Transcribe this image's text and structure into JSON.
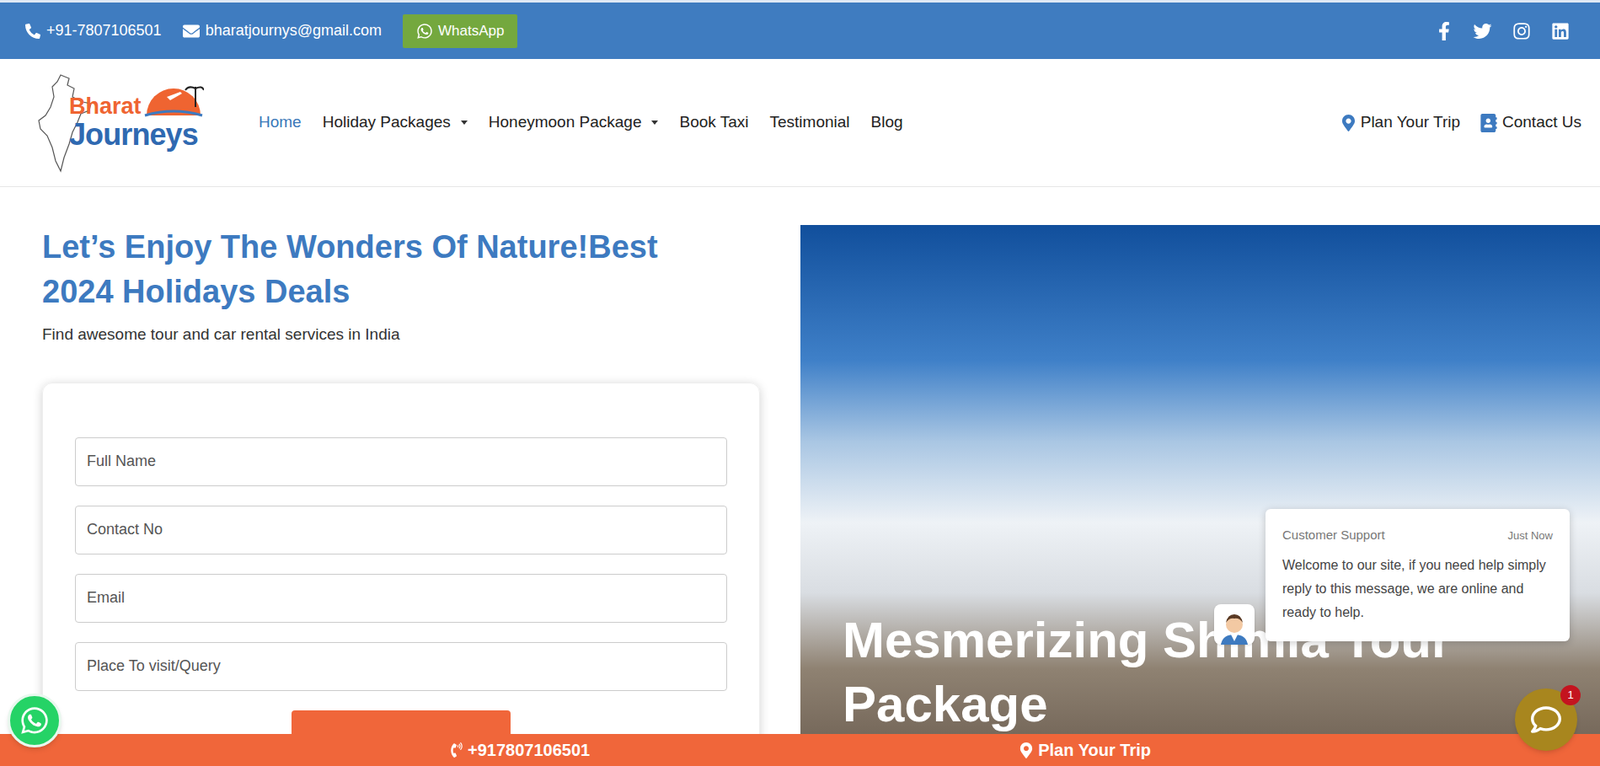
{
  "top_bar": {
    "phone": "+91-7807106501",
    "email": "bharatjournys@gmail.com",
    "whatsapp": "WhatsApp"
  },
  "logo": {
    "line1": "Bharat",
    "line2": "Journeys"
  },
  "nav": {
    "items": [
      {
        "label": "Home",
        "selected": true,
        "dropdown": false
      },
      {
        "label": "Holiday Packages",
        "selected": false,
        "dropdown": true
      },
      {
        "label": "Honeymoon Package",
        "selected": false,
        "dropdown": true
      },
      {
        "label": "Book Taxi",
        "selected": false,
        "dropdown": false
      },
      {
        "label": "Testimonial",
        "selected": false,
        "dropdown": false
      },
      {
        "label": "Blog",
        "selected": false,
        "dropdown": false
      }
    ],
    "actions": [
      {
        "label": "Plan Your Trip",
        "kind": "pin"
      },
      {
        "label": "Contact Us",
        "kind": "contact"
      }
    ]
  },
  "hero": {
    "heading": "Let’s Enjoy The Wonders Of Nature!Best 2024 Holidays Deals",
    "subtitle": "Find awesome tour and car rental services in India",
    "form": {
      "fields": [
        {
          "placeholder": "Full Name"
        },
        {
          "placeholder": "Contact No"
        },
        {
          "placeholder": "Email"
        },
        {
          "placeholder": "Place To visit/Query"
        }
      ]
    },
    "slide": {
      "caption": "Mesmerizing Shimla Tour Package"
    }
  },
  "chat": {
    "sender": "Customer Support",
    "time": "Just Now",
    "message": "Welcome to our site, if you need help simply reply to this message, we are online and ready to help.",
    "badge": "1"
  },
  "bottom_bar": {
    "phone": "+917807106501",
    "plan": "Plan Your Trip"
  }
}
